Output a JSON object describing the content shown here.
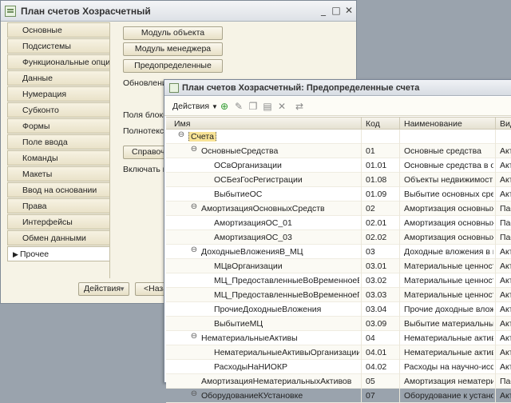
{
  "back_window": {
    "title": "План счетов Хозрасчетный",
    "controls": [
      "_",
      "□",
      "✕"
    ],
    "tabs": [
      "Основные",
      "Подсистемы",
      "Функциональные опции",
      "Данные",
      "Нумерация",
      "Субконто",
      "Формы",
      "Поле ввода",
      "Команды",
      "Макеты",
      "Ввод на основании",
      "Права",
      "Интерфейсы",
      "Обмен данными",
      "Прочее"
    ],
    "active_tab": "Прочее",
    "buttons": {
      "object_module": "Модуль объекта",
      "manager_module": "Модуль менеджера",
      "predefined": "Предопределенные",
      "help": "Справочн"
    },
    "labels": {
      "update": "Обновление",
      "block_fields": "Поля блокир",
      "fulltext": "Полнотекстс",
      "include": "Включать в с"
    },
    "footer": {
      "actions": "Действия",
      "back": "<Наза"
    }
  },
  "front_window": {
    "title": "План счетов Хозрасчетный: Предопределенные счета",
    "toolbar": {
      "actions": "Действия"
    },
    "columns": [
      "Имя",
      "Код",
      "Наименование",
      "Вид"
    ],
    "rows": [
      {
        "level": 0,
        "toggle": "⊖",
        "name": "Счета",
        "code": "",
        "desc": "",
        "kind": "",
        "selected": true
      },
      {
        "level": 1,
        "toggle": "⊖",
        "name": "ОсновныеСредства",
        "code": "01",
        "desc": "Основные средства",
        "kind": "Акти"
      },
      {
        "level": 2,
        "toggle": "",
        "name": "ОСвОрганизации",
        "code": "01.01",
        "desc": "Основные средства в ор...",
        "kind": "Акти"
      },
      {
        "level": 2,
        "toggle": "",
        "name": "ОСБезГосРегистрации",
        "code": "01.08",
        "desc": "Объекты недвижимости...",
        "kind": "Акти"
      },
      {
        "level": 2,
        "toggle": "",
        "name": "ВыбытиеОС",
        "code": "01.09",
        "desc": "Выбытие основных сред...",
        "kind": "Акти"
      },
      {
        "level": 1,
        "toggle": "⊖",
        "name": "АмортизацияОсновныхСредств",
        "code": "02",
        "desc": "Амортизация основных ...",
        "kind": "Пасс"
      },
      {
        "level": 2,
        "toggle": "",
        "name": "АмортизацияОС_01",
        "code": "02.01",
        "desc": "Амортизация основных ...",
        "kind": "Пасс"
      },
      {
        "level": 2,
        "toggle": "",
        "name": "АмортизацияОС_03",
        "code": "02.02",
        "desc": "Амортизация основных ...",
        "kind": "Пасс"
      },
      {
        "level": 1,
        "toggle": "⊖",
        "name": "ДоходныеВложенияВ_МЦ",
        "code": "03",
        "desc": "Доходные вложения в м...",
        "kind": "Акти"
      },
      {
        "level": 2,
        "toggle": "",
        "name": "МЦвОрганизации",
        "code": "03.01",
        "desc": "Материальные ценности...",
        "kind": "Акти"
      },
      {
        "level": 2,
        "toggle": "",
        "name": "МЦ_ПредоставленныеВоВременноеВлад...",
        "code": "03.02",
        "desc": "Материальные ценности...",
        "kind": "Акти"
      },
      {
        "level": 2,
        "toggle": "",
        "name": "МЦ_ПредоставленныеВоВременноеПол...",
        "code": "03.03",
        "desc": "Материальные ценности...",
        "kind": "Акти"
      },
      {
        "level": 2,
        "toggle": "",
        "name": "ПрочиеДоходныеВложения",
        "code": "03.04",
        "desc": "Прочие доходные вложе...",
        "kind": "Акти"
      },
      {
        "level": 2,
        "toggle": "",
        "name": "ВыбытиеМЦ",
        "code": "03.09",
        "desc": "Выбытие материальных ...",
        "kind": "Акти"
      },
      {
        "level": 1,
        "toggle": "⊖",
        "name": "НематериальныеАктивы",
        "code": "04",
        "desc": "Нематериальные активы",
        "kind": "Акти"
      },
      {
        "level": 2,
        "toggle": "",
        "name": "НематериальныеАктивыОрганизации",
        "code": "04.01",
        "desc": "Нематериальные активы",
        "kind": "Акти"
      },
      {
        "level": 2,
        "toggle": "",
        "name": "РасходыНаНИОКР",
        "code": "04.02",
        "desc": "Расходы на научно-иссл...",
        "kind": "Акти"
      },
      {
        "level": 1,
        "toggle": "",
        "name": "АмортизацияНематериальныхАктивов",
        "code": "05",
        "desc": "Амортизация нематериа...",
        "kind": "Пасс"
      },
      {
        "level": 1,
        "toggle": "⊖",
        "name": "ОборудованиеКУстановке",
        "code": "07",
        "desc": "Оборудование к установ...",
        "kind": "Акти"
      }
    ]
  }
}
